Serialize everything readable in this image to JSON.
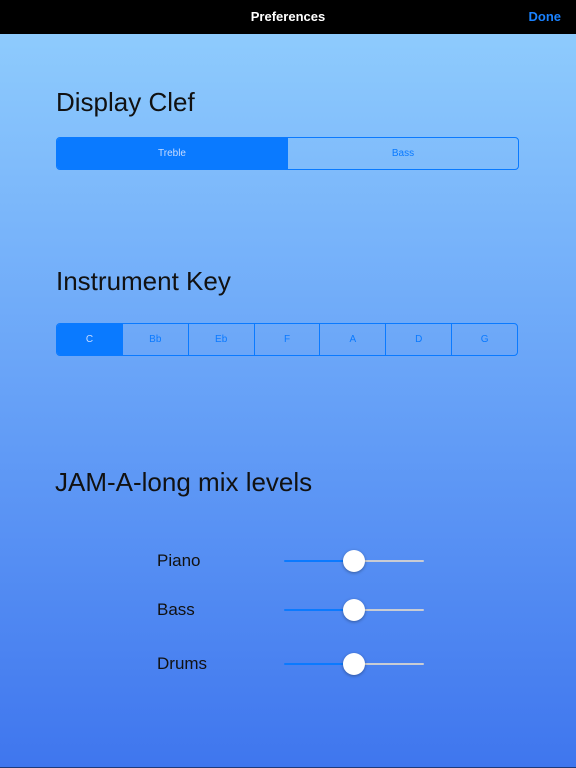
{
  "navbar": {
    "title": "Preferences",
    "done_label": "Done"
  },
  "display_clef": {
    "title": "Display Clef",
    "options": [
      "Treble",
      "Bass"
    ],
    "selected": "Treble"
  },
  "instrument_key": {
    "title": "Instrument Key",
    "options": [
      "C",
      "Bb",
      "Eb",
      "F",
      "A",
      "D",
      "G"
    ],
    "selected": "C"
  },
  "mix_levels": {
    "title": "JAM-A-long mix levels",
    "sliders": [
      {
        "label": "Piano",
        "value": 0.5
      },
      {
        "label": "Bass",
        "value": 0.5
      },
      {
        "label": "Drums",
        "value": 0.5
      }
    ]
  },
  "colors": {
    "accent": "#0a7aff",
    "done": "#1a82ff",
    "navbar_bg": "#000000",
    "gradient_top": "#8ecbfd",
    "gradient_bottom": "#3f76ee"
  }
}
